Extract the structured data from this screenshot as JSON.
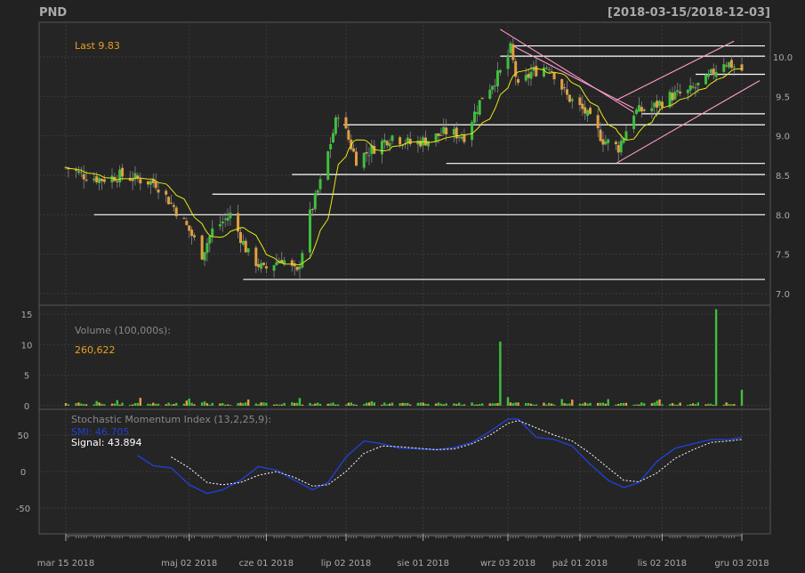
{
  "title": "PND",
  "date_range": "[2018-03-15/2018-12-03]",
  "colors": {
    "background": "#222222",
    "up": "#3fbf3f",
    "down": "#e0a040",
    "ma": "#e8e818",
    "last": "#e8a020",
    "smi": "#2040d0",
    "signal": "#ffffff",
    "grid": "#3a3a3a",
    "text": "#aaaaaa",
    "trend": "#ff9ccc",
    "hline": "#ffffff"
  },
  "chart_data": [
    {
      "type": "candlestick",
      "name": "price",
      "last_label": "Last 9.83",
      "ylim": [
        6.9,
        10.4
      ],
      "yticks": [
        "7.0",
        "7.5",
        "8.0",
        "8.5",
        "9.0",
        "9.5",
        "10.0"
      ],
      "ma_label": "",
      "support_resistance": [
        {
          "level": 10.14,
          "from": "2018-09-05",
          "to": "2018-12-03"
        },
        {
          "level": 10.01,
          "from": "2018-08-31",
          "to": "2018-12-03"
        },
        {
          "level": 9.78,
          "from": "2018-11-15",
          "to": "2018-12-03"
        },
        {
          "level": 9.28,
          "from": "2018-10-25",
          "to": "2018-12-03"
        },
        {
          "level": 9.14,
          "from": "2018-07-01",
          "to": "2018-12-03"
        },
        {
          "level": 8.65,
          "from": "2018-08-10",
          "to": "2018-12-03"
        },
        {
          "level": 8.51,
          "from": "2018-06-11",
          "to": "2018-12-03"
        },
        {
          "level": 8.26,
          "from": "2018-05-11",
          "to": "2018-12-03"
        },
        {
          "level": 8.0,
          "from": "2018-03-26",
          "to": "2018-12-03"
        },
        {
          "level": 7.18,
          "from": "2018-05-23",
          "to": "2018-12-03"
        }
      ],
      "trend_lines": [
        {
          "from": [
            "2018-08-31",
            10.35
          ],
          "to": [
            "2018-10-15",
            9.3
          ]
        },
        {
          "from": [
            "2018-09-05",
            10.14
          ],
          "to": [
            "2018-10-15",
            9.35
          ]
        },
        {
          "from": [
            "2018-10-15",
            9.45
          ],
          "to": [
            "2018-11-23",
            10.2
          ]
        },
        {
          "from": [
            "2018-10-15",
            8.65
          ],
          "to": [
            "2018-12-03",
            9.7
          ]
        }
      ]
    },
    {
      "type": "bar",
      "name": "volume",
      "label": "Volume (100,000s):",
      "last_value": "260,622",
      "ylim": [
        0,
        16
      ],
      "yticks": [
        "0",
        "5",
        "10",
        "15"
      ],
      "spikes": [
        {
          "date": "2018-08-31",
          "value": 10.5
        },
        {
          "date": "2018-09-03",
          "value": 1.4
        },
        {
          "date": "2018-11-23",
          "value": 15.8
        },
        {
          "date": "2018-12-03",
          "value": 2.6
        }
      ]
    },
    {
      "type": "line",
      "name": "smi",
      "label": "Stochastic Momentum Index (13,2,25,9):",
      "smi_label": "SMI: 46.705",
      "signal_label": "Signal: 43.894",
      "ylim": [
        -70,
        90
      ],
      "yticks": [
        "-50",
        "0",
        "50"
      ],
      "smi": [
        [
          "2018-04-12",
          22
        ],
        [
          "2018-04-18",
          8
        ],
        [
          "2018-04-25",
          5
        ],
        [
          "2018-05-02",
          -18
        ],
        [
          "2018-05-09",
          -30
        ],
        [
          "2018-05-15",
          -25
        ],
        [
          "2018-05-22",
          -12
        ],
        [
          "2018-05-29",
          7
        ],
        [
          "2018-06-05",
          2
        ],
        [
          "2018-06-12",
          -12
        ],
        [
          "2018-06-19",
          -25
        ],
        [
          "2018-06-25",
          -15
        ],
        [
          "2018-07-02",
          20
        ],
        [
          "2018-07-09",
          42
        ],
        [
          "2018-07-16",
          38
        ],
        [
          "2018-07-23",
          32
        ],
        [
          "2018-07-30",
          31
        ],
        [
          "2018-08-06",
          30
        ],
        [
          "2018-08-13",
          33
        ],
        [
          "2018-08-20",
          40
        ],
        [
          "2018-08-27",
          55
        ],
        [
          "2018-09-03",
          72
        ],
        [
          "2018-09-07",
          72
        ],
        [
          "2018-09-14",
          47
        ],
        [
          "2018-09-21",
          44
        ],
        [
          "2018-09-28",
          35
        ],
        [
          "2018-10-05",
          10
        ],
        [
          "2018-10-12",
          -12
        ],
        [
          "2018-10-18",
          -22
        ],
        [
          "2018-10-24",
          -15
        ],
        [
          "2018-10-31",
          14
        ],
        [
          "2018-11-07",
          32
        ],
        [
          "2018-11-14",
          38
        ],
        [
          "2018-11-21",
          44
        ],
        [
          "2018-11-28",
          44
        ],
        [
          "2018-12-03",
          47
        ]
      ],
      "signal": [
        [
          "2018-04-25",
          20
        ],
        [
          "2018-05-02",
          5
        ],
        [
          "2018-05-09",
          -15
        ],
        [
          "2018-05-15",
          -18
        ],
        [
          "2018-05-22",
          -15
        ],
        [
          "2018-05-29",
          -5
        ],
        [
          "2018-06-05",
          0
        ],
        [
          "2018-06-12",
          -8
        ],
        [
          "2018-06-19",
          -20
        ],
        [
          "2018-06-25",
          -18
        ],
        [
          "2018-07-02",
          0
        ],
        [
          "2018-07-09",
          25
        ],
        [
          "2018-07-16",
          35
        ],
        [
          "2018-07-23",
          34
        ],
        [
          "2018-07-30",
          32
        ],
        [
          "2018-08-06",
          30
        ],
        [
          "2018-08-13",
          31
        ],
        [
          "2018-08-20",
          38
        ],
        [
          "2018-08-27",
          50
        ],
        [
          "2018-09-03",
          66
        ],
        [
          "2018-09-07",
          70
        ],
        [
          "2018-09-14",
          60
        ],
        [
          "2018-09-21",
          50
        ],
        [
          "2018-09-28",
          42
        ],
        [
          "2018-10-05",
          25
        ],
        [
          "2018-10-12",
          5
        ],
        [
          "2018-10-18",
          -12
        ],
        [
          "2018-10-24",
          -14
        ],
        [
          "2018-10-31",
          -2
        ],
        [
          "2018-11-07",
          18
        ],
        [
          "2018-11-14",
          30
        ],
        [
          "2018-11-21",
          40
        ],
        [
          "2018-11-28",
          42
        ],
        [
          "2018-12-03",
          44
        ]
      ]
    }
  ],
  "x_axis": {
    "range": [
      "2018-03-15",
      "2018-12-03"
    ],
    "ticks": [
      {
        "date": "2018-03-15",
        "label": "mar 15 2018"
      },
      {
        "date": "2018-05-02",
        "label": "maj 02 2018"
      },
      {
        "date": "2018-06-01",
        "label": "cze 01 2018"
      },
      {
        "date": "2018-07-02",
        "label": "lip 02 2018"
      },
      {
        "date": "2018-08-01",
        "label": "sie 01 2018"
      },
      {
        "date": "2018-09-03",
        "label": "wrz 03 2018"
      },
      {
        "date": "2018-10-01",
        "label": "paź 01 2018"
      },
      {
        "date": "2018-11-02",
        "label": "lis 02 2018"
      },
      {
        "date": "2018-12-03",
        "label": "gru 03 2018"
      }
    ]
  },
  "price_waypoints": [
    [
      "2018-03-15",
      8.6
    ],
    [
      "2018-03-22",
      8.5
    ],
    [
      "2018-03-29",
      8.45
    ],
    [
      "2018-04-05",
      8.5
    ],
    [
      "2018-04-12",
      8.45
    ],
    [
      "2018-04-19",
      8.4
    ],
    [
      "2018-04-26",
      8.1
    ],
    [
      "2018-05-02",
      7.8
    ],
    [
      "2018-05-07",
      7.5
    ],
    [
      "2018-05-11",
      7.8
    ],
    [
      "2018-05-18",
      8.0
    ],
    [
      "2018-05-25",
      7.5
    ],
    [
      "2018-05-31",
      7.3
    ],
    [
      "2018-06-07",
      7.45
    ],
    [
      "2018-06-13",
      7.25
    ],
    [
      "2018-06-18",
      8.0
    ],
    [
      "2018-06-22",
      8.4
    ],
    [
      "2018-06-29",
      9.3
    ],
    [
      "2018-07-06",
      8.7
    ],
    [
      "2018-07-13",
      8.85
    ],
    [
      "2018-07-20",
      9.0
    ],
    [
      "2018-07-27",
      8.9
    ],
    [
      "2018-08-03",
      8.95
    ],
    [
      "2018-08-10",
      9.05
    ],
    [
      "2018-08-17",
      9.0
    ],
    [
      "2018-08-24",
      9.5
    ],
    [
      "2018-08-31",
      9.8
    ],
    [
      "2018-09-04",
      10.1
    ],
    [
      "2018-09-07",
      9.6
    ],
    [
      "2018-09-12",
      9.8
    ],
    [
      "2018-09-19",
      9.9
    ],
    [
      "2018-09-26",
      9.5
    ],
    [
      "2018-10-03",
      9.3
    ],
    [
      "2018-10-10",
      8.95
    ],
    [
      "2018-10-16",
      8.85
    ],
    [
      "2018-10-22",
      9.3
    ],
    [
      "2018-10-29",
      9.35
    ],
    [
      "2018-11-05",
      9.5
    ],
    [
      "2018-11-12",
      9.55
    ],
    [
      "2018-11-19",
      9.7
    ],
    [
      "2018-11-26",
      9.95
    ],
    [
      "2018-12-03",
      9.83
    ]
  ]
}
